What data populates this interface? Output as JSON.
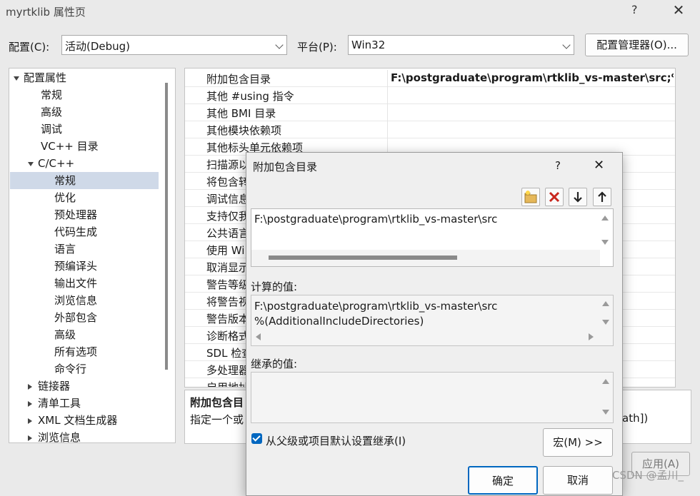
{
  "window": {
    "title": "myrtklib 属性页",
    "help": "?",
    "close": "✕"
  },
  "toolbar": {
    "config_label": "配置(C):",
    "config_value": "活动(Debug)",
    "platform_label": "平台(P):",
    "platform_value": "Win32",
    "config_manager": "配置管理器(O)..."
  },
  "tree": {
    "items": [
      {
        "label": "配置属性"
      },
      {
        "label": "常规"
      },
      {
        "label": "高级"
      },
      {
        "label": "调试"
      },
      {
        "label": "VC++ 目录"
      },
      {
        "label": "C/C++"
      },
      {
        "label": "常规"
      },
      {
        "label": "优化"
      },
      {
        "label": "预处理器"
      },
      {
        "label": "代码生成"
      },
      {
        "label": "语言"
      },
      {
        "label": "预编译头"
      },
      {
        "label": "输出文件"
      },
      {
        "label": "浏览信息"
      },
      {
        "label": "外部包含"
      },
      {
        "label": "高级"
      },
      {
        "label": "所有选项"
      },
      {
        "label": "命令行"
      },
      {
        "label": "链接器"
      },
      {
        "label": "清单工具"
      },
      {
        "label": "XML 文档生成器"
      },
      {
        "label": "浏览信息"
      }
    ]
  },
  "grid": {
    "rows": [
      {
        "name": "附加包含目录",
        "value": "F:\\postgraduate\\program\\rtklib_vs-master\\src;%"
      },
      {
        "name": "其他 #using 指令",
        "value": ""
      },
      {
        "name": "其他 BMI 目录",
        "value": ""
      },
      {
        "name": "其他模块依赖项",
        "value": ""
      },
      {
        "name": "其他标头单元依赖项",
        "value": ""
      },
      {
        "name": "扫描源以",
        "value": ""
      },
      {
        "name": "将包含转",
        "value": ""
      },
      {
        "name": "调试信息",
        "value": ""
      },
      {
        "name": "支持仅我",
        "value": ""
      },
      {
        "name": "公共语言",
        "value": ""
      },
      {
        "name": "使用 Wi",
        "value": ""
      },
      {
        "name": "取消显示",
        "value": ""
      },
      {
        "name": "警告等级",
        "value": ""
      },
      {
        "name": "将警告视",
        "value": ""
      },
      {
        "name": "警告版本",
        "value": ""
      },
      {
        "name": "诊断格式",
        "value": ""
      },
      {
        "name": "SDL 检查",
        "value": ""
      },
      {
        "name": "多处理器",
        "value": ""
      },
      {
        "name": "启用地址",
        "value": ""
      }
    ]
  },
  "description": {
    "title": "附加包含目",
    "text": "指定一个或",
    "suffix": "ath])"
  },
  "footer": {
    "apply": "应用(A)"
  },
  "watermark": "CSDN @孟川_",
  "dialog": {
    "title": "附加包含目录",
    "help": "?",
    "close": "✕",
    "edit_value": "F:\\postgraduate\\program\\rtklib_vs-master\\src",
    "computed_label": "计算的值:",
    "computed_lines": [
      "F:\\postgraduate\\program\\rtklib_vs-master\\src",
      "%(AdditionalIncludeDirectories)"
    ],
    "inherited_label": "继承的值:",
    "inherit_checkbox": "从父级或项目默认设置继承(I)",
    "inherit_checked": true,
    "macro_button": "宏(M) >>",
    "ok_button": "确定",
    "cancel_button": "取消"
  }
}
